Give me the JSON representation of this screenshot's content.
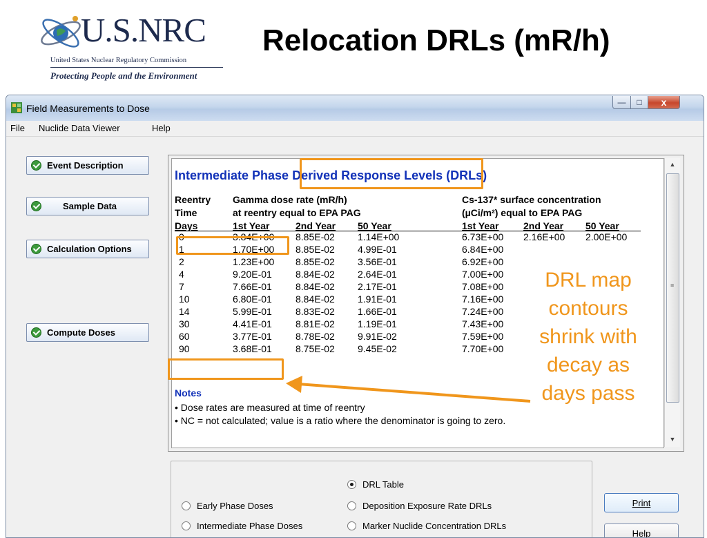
{
  "slide": {
    "title": "Relocation DRLs (mR/h)",
    "logo": {
      "wordmark": "U.S.NRC",
      "commission": "United States Nuclear Regulatory Commission",
      "tagline": "Protecting People and the Environment"
    }
  },
  "window": {
    "title": "Field Measurements to Dose",
    "close_glyph": "x",
    "minimize_glyph": "—",
    "maximize_glyph": "□"
  },
  "menu": {
    "file": "File",
    "nuclide": "Nuclide Data Viewer",
    "help": "Help"
  },
  "actions": {
    "event_description": "Event Description",
    "sample_data": "Sample Data",
    "calculation_options": "Calculation Options",
    "compute_doses": "Compute Doses"
  },
  "report": {
    "title": "Intermediate Phase Derived Response Levels (DRLs)",
    "headers": {
      "reentry": "Reentry",
      "time": "Time",
      "days": "Days",
      "gamma_line1": "Gamma dose rate (mR/h)",
      "gamma_line2": "at reentry equal to EPA PAG",
      "cs_line1": "Cs-137*  surface concentration",
      "cs_line2": "(µCi/m²) equal to EPA PAG",
      "year1": "1st Year",
      "year2": "2nd Year",
      "year50": "50 Year"
    },
    "rows": [
      {
        "days": "0",
        "g1": "3.84E+00",
        "g2": "8.85E-02",
        "g50": "1.14E+00",
        "c1": "6.73E+00",
        "c2": "2.16E+00",
        "c50": "2.00E+00"
      },
      {
        "days": "1",
        "g1": "1.70E+00",
        "g2": "8.85E-02",
        "g50": "4.99E-01",
        "c1": "6.84E+00",
        "c2": "",
        "c50": ""
      },
      {
        "days": "2",
        "g1": "1.23E+00",
        "g2": "8.85E-02",
        "g50": "3.56E-01",
        "c1": "6.92E+00",
        "c2": "",
        "c50": ""
      },
      {
        "days": "4",
        "g1": "9.20E-01",
        "g2": "8.84E-02",
        "g50": "2.64E-01",
        "c1": "7.00E+00",
        "c2": "",
        "c50": ""
      },
      {
        "days": "7",
        "g1": "7.66E-01",
        "g2": "8.84E-02",
        "g50": "2.17E-01",
        "c1": "7.08E+00",
        "c2": "",
        "c50": ""
      },
      {
        "days": "10",
        "g1": "6.80E-01",
        "g2": "8.84E-02",
        "g50": "1.91E-01",
        "c1": "7.16E+00",
        "c2": "",
        "c50": ""
      },
      {
        "days": "14",
        "g1": "5.99E-01",
        "g2": "8.83E-02",
        "g50": "1.66E-01",
        "c1": "7.24E+00",
        "c2": "",
        "c50": ""
      },
      {
        "days": "30",
        "g1": "4.41E-01",
        "g2": "8.81E-02",
        "g50": "1.19E-01",
        "c1": "7.43E+00",
        "c2": "",
        "c50": ""
      },
      {
        "days": "60",
        "g1": "3.77E-01",
        "g2": "8.78E-02",
        "g50": "9.91E-02",
        "c1": "7.59E+00",
        "c2": "",
        "c50": ""
      },
      {
        "days": "90",
        "g1": "3.68E-01",
        "g2": "8.75E-02",
        "g50": "9.45E-02",
        "c1": "7.70E+00",
        "c2": "",
        "c50": ""
      }
    ],
    "notes_title": "Notes",
    "notes": [
      "• Dose rates are measured at time of reentry",
      "• NC = not calculated; value is a ratio where the denominator is going to zero."
    ]
  },
  "callout": {
    "lines": [
      "DRL map",
      "contours",
      "shrink with",
      "decay as",
      "days pass"
    ]
  },
  "options": {
    "drl_table": "DRL Table",
    "early_phase": "Early Phase Doses",
    "deposition": "Deposition Exposure Rate DRLs",
    "intermediate_phase": "Intermediate Phase Doses",
    "marker_nuclide": "Marker Nuclide Concentration DRLs",
    "selected": "DRL Table"
  },
  "buttons": {
    "print": "Print",
    "help": "Help"
  },
  "colors": {
    "accent_orange": "#f0961c",
    "report_blue": "#1232b8",
    "nrc_navy": "#1d2a4d"
  }
}
